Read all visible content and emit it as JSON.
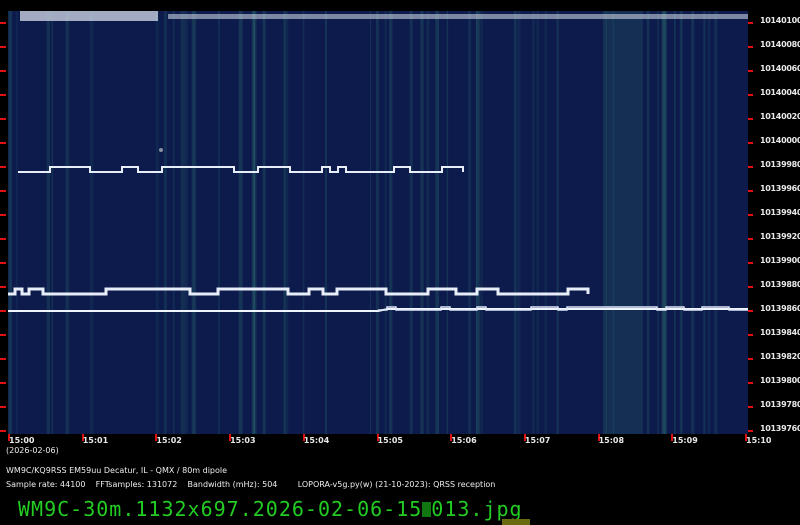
{
  "y_axis_labels": [
    "10140100",
    "10140080",
    "10140060",
    "10140040",
    "10140020",
    "10140000",
    "10139980",
    "10139960",
    "10139940",
    "10139920",
    "10139900",
    "10139880",
    "10139860",
    "10139840",
    "10139820",
    "10139800",
    "10139780",
    "10139760"
  ],
  "x_axis_labels": [
    "15:00",
    "15:01",
    "15:02",
    "15:03",
    "15:04",
    "15:05",
    "15:06",
    "15:07",
    "15:08",
    "15:09",
    "15:10"
  ],
  "date": "(2026-02-06)",
  "station": "WM9C/KQ9RSS EM59uu Decatur, IL - QMX / 80m dipole",
  "params": "Sample rate: 44100    FFTsamples: 131072    Bandwidth (mHz): 504        LOPORA-v5g.py(w) (21-10-2023): QRSS reception",
  "filename_prefix": "WM9C-30m.1132x697.2026-02-06-15",
  "filename_suffix": "013.jpg",
  "colors": {
    "background": "#0c1a4c",
    "tick": "#e01010",
    "filename": "#22cc22"
  }
}
